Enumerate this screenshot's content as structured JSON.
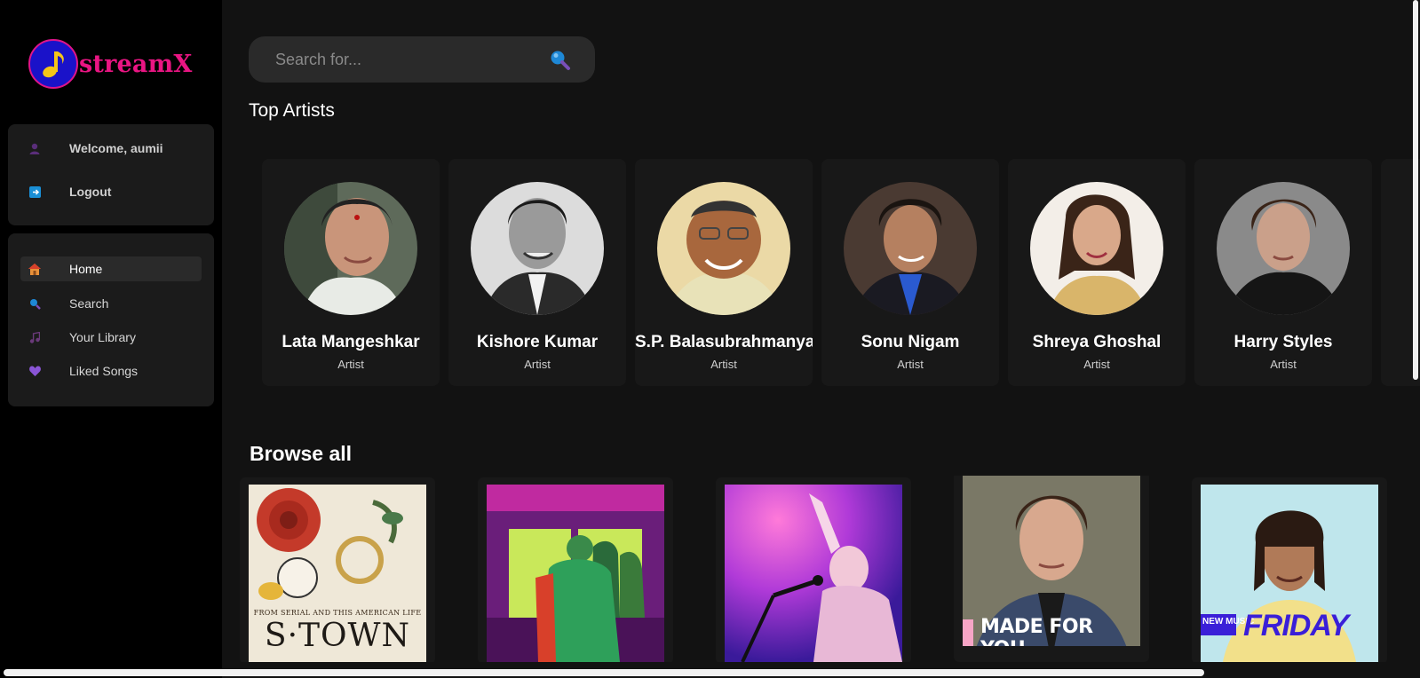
{
  "app": {
    "brand": "streamX"
  },
  "user_panel": {
    "welcome": "Welcome, aumii",
    "logout": "Logout"
  },
  "nav": {
    "items": [
      {
        "label": "Home",
        "icon": "home-icon",
        "active": true
      },
      {
        "label": "Search",
        "icon": "search-icon",
        "active": false
      },
      {
        "label": "Your Library",
        "icon": "music-note-icon",
        "active": false
      },
      {
        "label": "Liked Songs",
        "icon": "heart-icon",
        "active": false
      }
    ]
  },
  "search": {
    "placeholder": "Search for..."
  },
  "top_artists": {
    "title": "Top Artists",
    "items": [
      {
        "name": "Lata Mangeshkar",
        "role": "Artist"
      },
      {
        "name": "Kishore Kumar",
        "role": "Artist"
      },
      {
        "name": "S.P. Balasubrahmanyam",
        "role": "Artist"
      },
      {
        "name": "Sonu Nigam",
        "role": "Artist"
      },
      {
        "name": "Shreya Ghoshal",
        "role": "Artist"
      },
      {
        "name": "Harry Styles",
        "role": "Artist"
      }
    ]
  },
  "browse_all": {
    "title": "Browse all",
    "tiles": [
      {
        "caption": "S·TOWN",
        "subcaption": "FROM SERIAL AND THIS AMERICAN LIFE"
      },
      {
        "caption": ""
      },
      {
        "caption": ""
      },
      {
        "caption": "MADE FOR YOU"
      },
      {
        "caption": "FRIDAY",
        "subcaption": "NEW MUSIC"
      }
    ]
  },
  "colors": {
    "brand_pink": "#ea1583",
    "logo_blue": "#1a12c9",
    "background": "#121212",
    "card": "#181818"
  }
}
